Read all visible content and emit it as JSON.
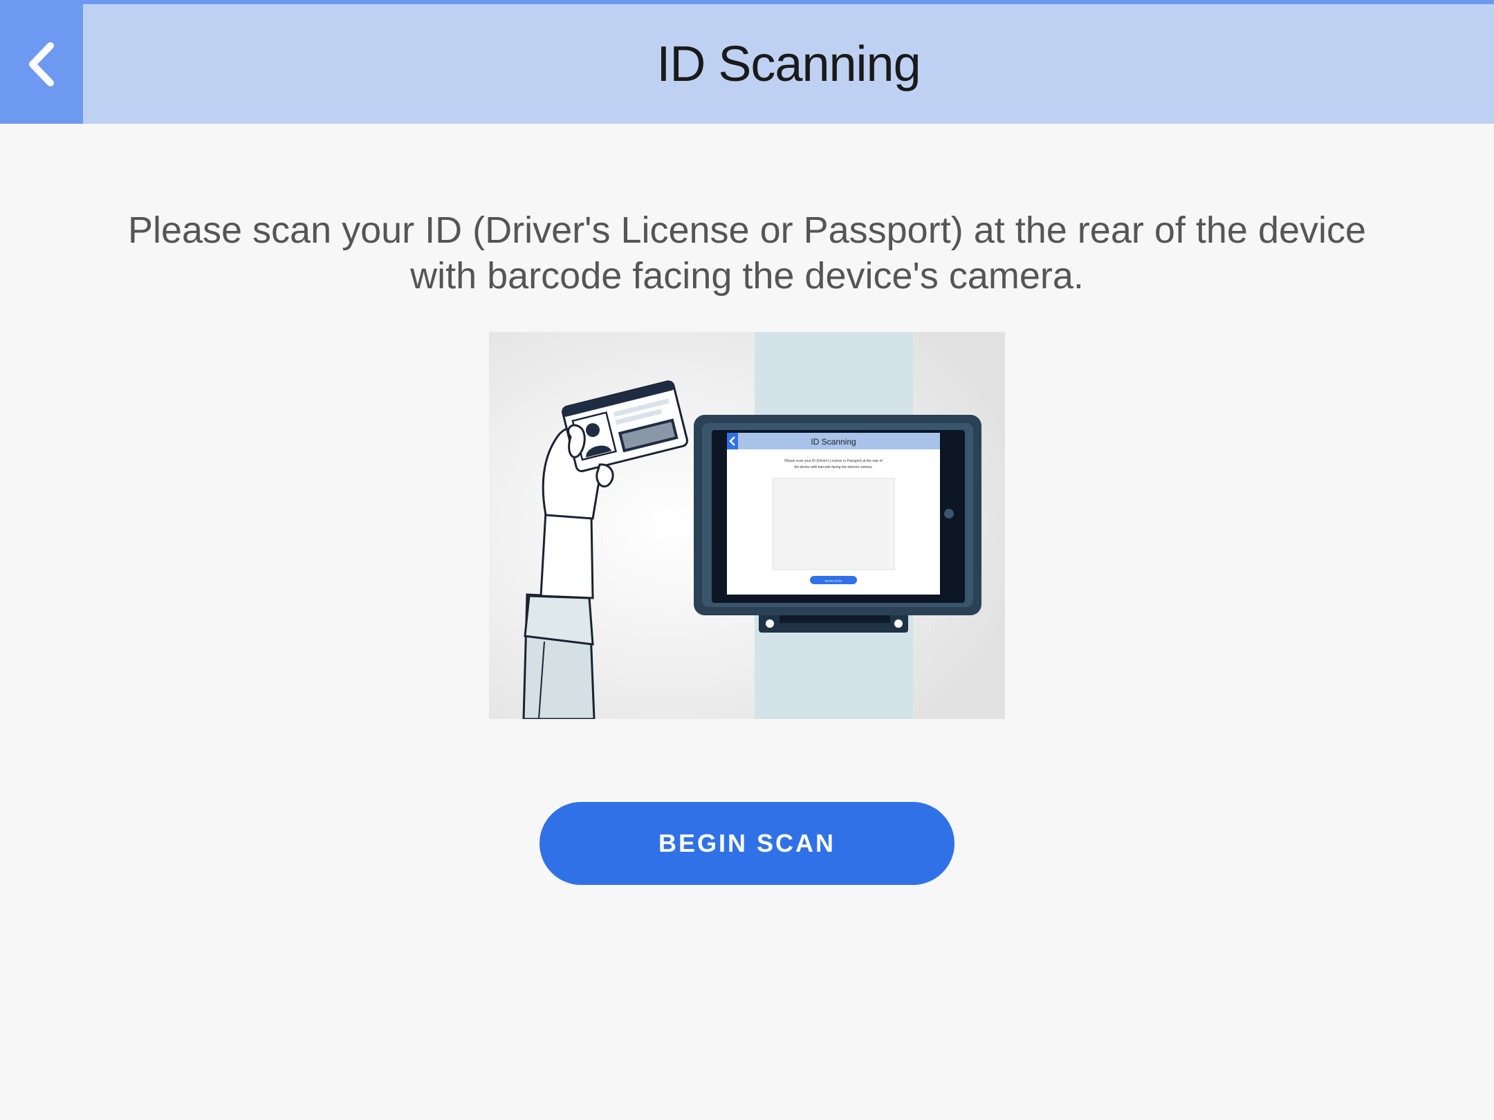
{
  "header": {
    "title": "ID Scanning",
    "back_icon": "chevron-left-icon"
  },
  "main": {
    "instructions": "Please scan your ID (Driver's License or Passport) at the rear of the device with barcode facing the device's camera.",
    "illustration": {
      "screen_title": "ID Scanning",
      "screen_text_line1": "Please scan your ID (Driver's License or Passport) at the rear of",
      "screen_text_line2": "the device with barcode facing the devices camera.",
      "screen_button": "BEGIN SCAN"
    },
    "begin_button": "BEGIN SCAN"
  },
  "colors": {
    "accent": "#3071e8",
    "header_bg": "#bfd1f3",
    "back_bg": "#6d9af0",
    "page_bg": "#f7f7f7"
  }
}
